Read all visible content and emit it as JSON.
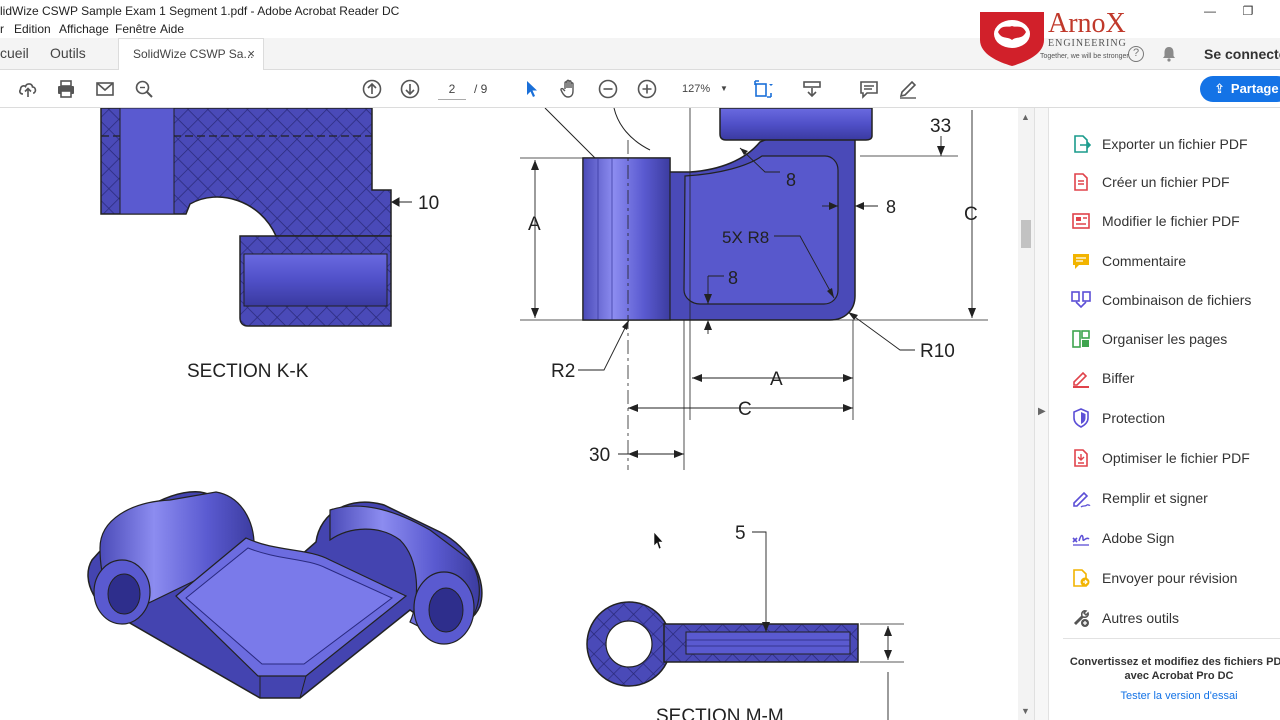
{
  "window": {
    "title": "lidWize CSWP Sample Exam 1 Segment 1.pdf - Adobe Acrobat Reader DC",
    "minimize": "—",
    "maximize": "❐"
  },
  "menu": [
    "r",
    "Edition",
    "Affichage",
    "Fenêtre",
    "Aide"
  ],
  "tabs": {
    "home": "cueil",
    "tools": "Outils",
    "document": "SolidWize CSWP Sa...",
    "close": "×"
  },
  "header": {
    "connect": "Se connecte",
    "help": "?"
  },
  "logo": {
    "name": "ArnoX",
    "sub": "ENGINEERING",
    "tagline": "Together, we will be stronger"
  },
  "toolbar": {
    "page_current": "2",
    "page_total": "/ 9",
    "zoom": "127%",
    "share": "Partage"
  },
  "drawing": {
    "section_kk": "SECTION K-K",
    "section_mm": "SECTION M-M",
    "dim_10": "10",
    "dim_33": "33",
    "dim_8a": "8",
    "dim_8b": "8",
    "dim_8c": "8",
    "dim_5xr8": "5X R8",
    "dim_A_vert": "A",
    "dim_C_vert": "C",
    "dim_R2": "R2",
    "dim_R10": "R10",
    "dim_A_horiz": "A",
    "dim_C_horiz": "C",
    "dim_30": "30",
    "dim_5": "5"
  },
  "tools_panel": {
    "items": [
      {
        "label": "Exporter un fichier PDF",
        "icon": "export-pdf-icon",
        "color": "#1a9b8c"
      },
      {
        "label": "Créer un fichier PDF",
        "icon": "create-pdf-icon",
        "color": "#e0434b"
      },
      {
        "label": "Modifier le fichier PDF",
        "icon": "edit-pdf-icon",
        "color": "#e0434b"
      },
      {
        "label": "Commentaire",
        "icon": "comment-icon",
        "color": "#f2b400"
      },
      {
        "label": "Combinaison de fichiers",
        "icon": "combine-files-icon",
        "color": "#5c4fd6"
      },
      {
        "label": "Organiser les pages",
        "icon": "organize-pages-icon",
        "color": "#3ea44e"
      },
      {
        "label": "Biffer",
        "icon": "redact-icon",
        "color": "#e0434b"
      },
      {
        "label": "Protection",
        "icon": "protect-shield-icon",
        "color": "#5c4fd6"
      },
      {
        "label": "Optimiser le fichier PDF",
        "icon": "optimize-pdf-icon",
        "color": "#e0434b"
      },
      {
        "label": "Remplir et signer",
        "icon": "fill-sign-icon",
        "color": "#5c4fd6"
      },
      {
        "label": "Adobe Sign",
        "icon": "adobe-sign-icon",
        "color": "#5c4fd6"
      },
      {
        "label": "Envoyer pour révision",
        "icon": "send-review-icon",
        "color": "#f2b400"
      },
      {
        "label": "Autres outils",
        "icon": "more-tools-icon",
        "color": "#555555"
      }
    ],
    "promo": "Convertissez et modifiez des fichiers PDF avec Acrobat Pro DC",
    "trial": "Tester la version d'essai"
  },
  "colors": {
    "part": "#5a5ad0",
    "part_dark": "#3c3ca8",
    "accent": "#1473e6"
  }
}
